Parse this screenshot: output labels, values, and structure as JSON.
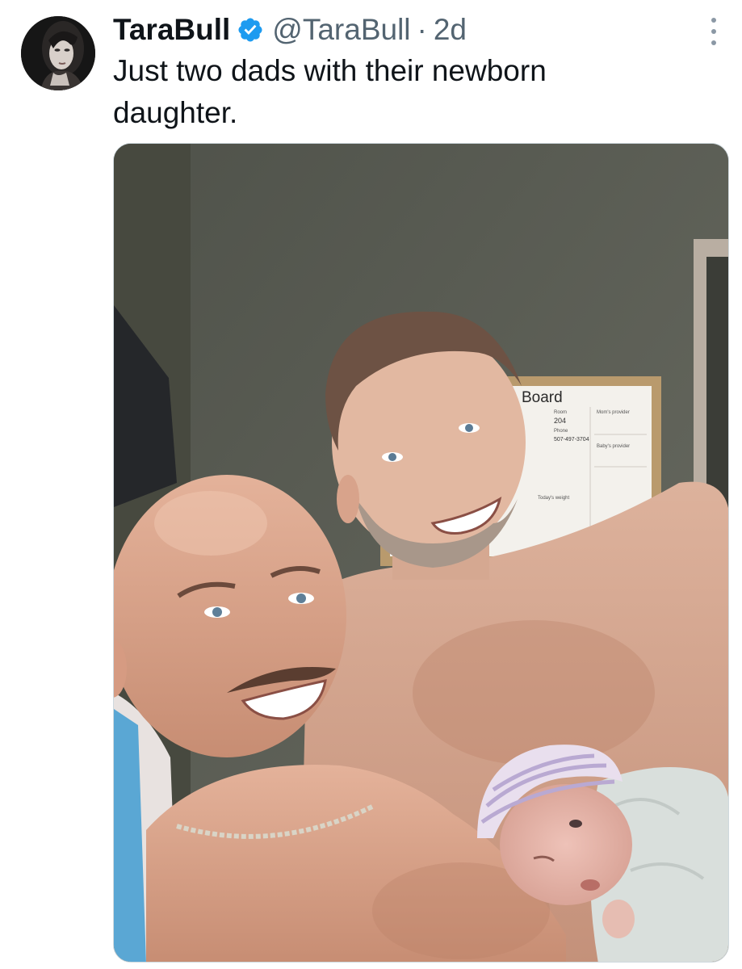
{
  "tweet": {
    "display_name": "TaraBull",
    "handle": "@TaraBull",
    "separator": "·",
    "time": "2d",
    "text": "Just two dads with their newborn\ndaughter.",
    "verified_color": "#1d9bf0",
    "verified_icon": "verified-badge-icon",
    "more_icon": "more-options-icon"
  },
  "photo": {
    "board_title": "Board",
    "board_room_label": "Room",
    "board_room": "204",
    "board_phone_label": "Phone",
    "board_phone": "507-497-3704",
    "board_mom_label": "Mom's provider",
    "board_baby_label": "Baby's provider",
    "board_weight_label": "Today's weight"
  }
}
